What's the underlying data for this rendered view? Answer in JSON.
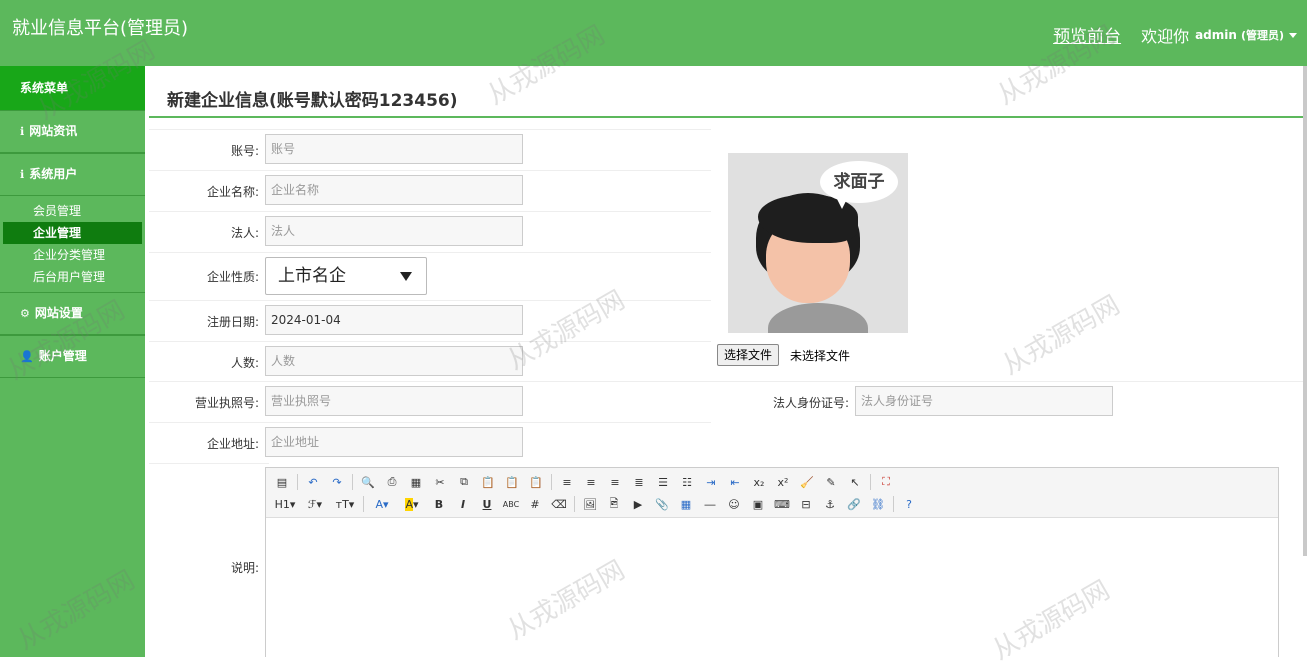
{
  "header": {
    "brand": "就业信息平台(管理员)",
    "preview_link": "预览前台",
    "welcome": "欢迎你",
    "admin_name": "admin",
    "admin_role": "(管理员)"
  },
  "sidebar": {
    "title": "系统菜单",
    "groups": [
      {
        "label": "网站资讯",
        "icon": "info-icon"
      },
      {
        "label": "系统用户",
        "icon": "info-icon"
      },
      {
        "label": "网站设置",
        "icon": "gear-icon"
      },
      {
        "label": "账户管理",
        "icon": "user-icon"
      }
    ],
    "sub_items": [
      "会员管理",
      "企业管理",
      "企业分类管理",
      "后台用户管理"
    ],
    "active_item": "企业管理"
  },
  "page": {
    "title": "新建企业信息(账号默认密码123456)"
  },
  "form": {
    "account": {
      "label": "账号:",
      "placeholder": "账号"
    },
    "company_name": {
      "label": "企业名称:",
      "placeholder": "企业名称"
    },
    "legal_person": {
      "label": "法人:",
      "placeholder": "法人"
    },
    "company_type": {
      "label": "企业性质:",
      "value": "上市名企"
    },
    "reg_date": {
      "label": "注册日期:",
      "value": "2024-01-04"
    },
    "headcount": {
      "label": "人数:",
      "placeholder": "人数"
    },
    "license": {
      "label": "营业执照号:",
      "placeholder": "营业执照号"
    },
    "legal_id": {
      "label": "法人身份证号:",
      "placeholder": "法人身份证号"
    },
    "address": {
      "label": "企业地址:",
      "placeholder": "企业地址"
    },
    "description": {
      "label": "说明:"
    },
    "avatar_bubble": "求面子",
    "file_button": "选择文件",
    "file_status": "未选择文件"
  },
  "watermark": "从戎源码网",
  "colors": {
    "brand_green": "#5cb85c",
    "active_green": "#0f7c0f",
    "header_green": "#18a718"
  }
}
